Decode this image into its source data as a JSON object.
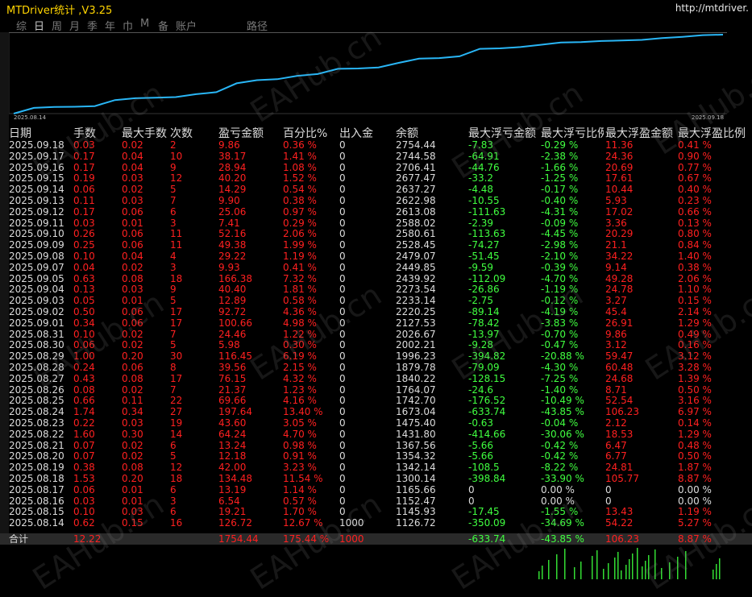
{
  "app_title": "MTDriver统计 ,V3.25",
  "url": "http://mtdriver.",
  "tabs": [
    "综",
    "日",
    "周",
    "月",
    "季",
    "年",
    "巾",
    "M",
    "备",
    "账户",
    "路径"
  ],
  "active_tab": "日",
  "chart": {
    "start_label": "2025.08.14",
    "end_label": "2025.09.18",
    "line_color": "#29b6f6"
  },
  "headers": [
    "日期",
    "手数",
    "最大手数",
    "次数",
    "盈亏金额",
    "百分比%",
    "出入金",
    "余额",
    "最大浮亏金额",
    "最大浮亏比例",
    "最大浮盈金额",
    "最大浮盈比例"
  ],
  "rows": [
    [
      "2025.09.18",
      "0.03",
      "0.02",
      "2",
      "9.86",
      "0.36 %",
      "0",
      "2754.44",
      "-7.83",
      "-0.29 %",
      "11.36",
      "0.41 %"
    ],
    [
      "2025.09.17",
      "0.17",
      "0.04",
      "10",
      "38.17",
      "1.41 %",
      "0",
      "2744.58",
      "-64.91",
      "-2.38 %",
      "24.36",
      "0.90 %"
    ],
    [
      "2025.09.16",
      "0.17",
      "0.04",
      "9",
      "28.94",
      "1.08 %",
      "0",
      "2706.41",
      "-44.76",
      "-1.66 %",
      "20.69",
      "0.77 %"
    ],
    [
      "2025.09.15",
      "0.19",
      "0.03",
      "12",
      "40.20",
      "1.52 %",
      "0",
      "2677.47",
      "-33.2",
      "-1.25 %",
      "17.61",
      "0.67 %"
    ],
    [
      "2025.09.14",
      "0.06",
      "0.02",
      "5",
      "14.29",
      "0.54 %",
      "0",
      "2637.27",
      "-4.48",
      "-0.17 %",
      "10.44",
      "0.40 %"
    ],
    [
      "2025.09.13",
      "0.11",
      "0.03",
      "7",
      "9.90",
      "0.38 %",
      "0",
      "2622.98",
      "-10.55",
      "-0.40 %",
      "5.93",
      "0.23 %"
    ],
    [
      "2025.09.12",
      "0.17",
      "0.06",
      "6",
      "25.06",
      "0.97 %",
      "0",
      "2613.08",
      "-111.63",
      "-4.31 %",
      "17.02",
      "0.66 %"
    ],
    [
      "2025.09.11",
      "0.03",
      "0.01",
      "3",
      "7.41",
      "0.29 %",
      "0",
      "2588.02",
      "-2.39",
      "-0.09 %",
      "3.36",
      "0.13 %"
    ],
    [
      "2025.09.10",
      "0.26",
      "0.06",
      "11",
      "52.16",
      "2.06 %",
      "0",
      "2580.61",
      "-113.63",
      "-4.45 %",
      "20.29",
      "0.80 %"
    ],
    [
      "2025.09.09",
      "0.25",
      "0.06",
      "11",
      "49.38",
      "1.99 %",
      "0",
      "2528.45",
      "-74.27",
      "-2.98 %",
      "21.1",
      "0.84 %"
    ],
    [
      "2025.09.08",
      "0.10",
      "0.04",
      "4",
      "29.22",
      "1.19 %",
      "0",
      "2479.07",
      "-51.45",
      "-2.10 %",
      "34.22",
      "1.40 %"
    ],
    [
      "2025.09.07",
      "0.04",
      "0.02",
      "3",
      "9.93",
      "0.41 %",
      "0",
      "2449.85",
      "-9.59",
      "-0.39 %",
      "9.14",
      "0.38 %"
    ],
    [
      "2025.09.05",
      "0.63",
      "0.08",
      "18",
      "166.38",
      "7.32 %",
      "0",
      "2439.92",
      "-112.09",
      "-4.70 %",
      "49.28",
      "2.06 %"
    ],
    [
      "2025.09.04",
      "0.13",
      "0.03",
      "9",
      "40.40",
      "1.81 %",
      "0",
      "2273.54",
      "-26.86",
      "-1.19 %",
      "24.78",
      "1.10 %"
    ],
    [
      "2025.09.03",
      "0.05",
      "0.01",
      "5",
      "12.89",
      "0.58 %",
      "0",
      "2233.14",
      "-2.75",
      "-0.12 %",
      "3.27",
      "0.15 %"
    ],
    [
      "2025.09.02",
      "0.50",
      "0.06",
      "17",
      "92.72",
      "4.36 %",
      "0",
      "2220.25",
      "-89.14",
      "-4.19 %",
      "45.4",
      "2.14 %"
    ],
    [
      "2025.09.01",
      "0.34",
      "0.06",
      "17",
      "100.66",
      "4.98 %",
      "0",
      "2127.53",
      "-78.42",
      "-3.83 %",
      "26.91",
      "1.29 %"
    ],
    [
      "2025.08.31",
      "0.10",
      "0.02",
      "7",
      "24.46",
      "1.22 %",
      "0",
      "2026.67",
      "-13.97",
      "-0.70 %",
      "9.86",
      "0.49 %"
    ],
    [
      "2025.08.30",
      "0.06",
      "0.02",
      "5",
      "5.98",
      "0.30 %",
      "0",
      "2002.21",
      "-9.28",
      "-0.47 %",
      "3.12",
      "0.16 %"
    ],
    [
      "2025.08.29",
      "1.00",
      "0.20",
      "30",
      "116.45",
      "6.19 %",
      "0",
      "1996.23",
      "-394.82",
      "-20.88 %",
      "59.47",
      "3.12 %"
    ],
    [
      "2025.08.28",
      "0.24",
      "0.06",
      "8",
      "39.56",
      "2.15 %",
      "0",
      "1879.78",
      "-79.09",
      "-4.30 %",
      "60.48",
      "3.28 %"
    ],
    [
      "2025.08.27",
      "0.43",
      "0.08",
      "17",
      "76.15",
      "4.32 %",
      "0",
      "1840.22",
      "-128.15",
      "-7.25 %",
      "24.68",
      "1.39 %"
    ],
    [
      "2025.08.26",
      "0.08",
      "0.02",
      "7",
      "21.37",
      "1.23 %",
      "0",
      "1764.07",
      "-24.6",
      "-1.40 %",
      "8.71",
      "0.50 %"
    ],
    [
      "2025.08.25",
      "0.66",
      "0.11",
      "22",
      "69.66",
      "4.16 %",
      "0",
      "1742.70",
      "-176.52",
      "-10.49 %",
      "52.54",
      "3.16 %"
    ],
    [
      "2025.08.24",
      "1.74",
      "0.34",
      "27",
      "197.64",
      "13.40 %",
      "0",
      "1673.04",
      "-633.74",
      "-43.85 %",
      "106.23",
      "6.97 %"
    ],
    [
      "2025.08.23",
      "0.22",
      "0.03",
      "19",
      "43.60",
      "3.05 %",
      "0",
      "1475.40",
      "-0.63",
      "-0.04 %",
      "2.12",
      "0.14 %"
    ],
    [
      "2025.08.22",
      "1.60",
      "0.30",
      "14",
      "64.24",
      "4.70 %",
      "0",
      "1431.80",
      "-414.66",
      "-30.06 %",
      "18.53",
      "1.29 %"
    ],
    [
      "2025.08.21",
      "0.07",
      "0.02",
      "6",
      "13.24",
      "0.98 %",
      "0",
      "1367.56",
      "-5.66",
      "-0.42 %",
      "6.47",
      "0.48 %"
    ],
    [
      "2025.08.20",
      "0.07",
      "0.02",
      "5",
      "12.18",
      "0.91 %",
      "0",
      "1354.32",
      "-5.66",
      "-0.42 %",
      "6.77",
      "0.50 %"
    ],
    [
      "2025.08.19",
      "0.38",
      "0.08",
      "12",
      "42.00",
      "3.23 %",
      "0",
      "1342.14",
      "-108.5",
      "-8.22 %",
      "24.81",
      "1.87 %"
    ],
    [
      "2025.08.18",
      "1.53",
      "0.20",
      "18",
      "134.48",
      "11.54 %",
      "0",
      "1300.14",
      "-398.84",
      "-33.90 %",
      "105.77",
      "8.87 %"
    ],
    [
      "2025.08.17",
      "0.06",
      "0.01",
      "6",
      "13.19",
      "1.14 %",
      "0",
      "1165.66",
      "0",
      "0.00 %",
      "0",
      "0.00 %"
    ],
    [
      "2025.08.16",
      "0.03",
      "0.01",
      "3",
      "6.54",
      "0.57 %",
      "0",
      "1152.47",
      "0",
      "0.00 %",
      "0",
      "0.00 %"
    ],
    [
      "2025.08.15",
      "0.10",
      "0.03",
      "6",
      "19.21",
      "1.70 %",
      "0",
      "1145.93",
      "-17.45",
      "-1.55 %",
      "13.43",
      "1.19 %"
    ],
    [
      "2025.08.14",
      "0.62",
      "0.15",
      "16",
      "126.72",
      "12.67 %",
      "1000",
      "1126.72",
      "-350.09",
      "-34.69 %",
      "54.22",
      "5.27 %"
    ]
  ],
  "total": {
    "label": "合计",
    "lots": "12.22",
    "pl": "1754.44",
    "pct": "175.44 %",
    "deposit": "1000",
    "float_loss": "-633.74",
    "float_loss_pct": "-43.85 %",
    "float_profit": "106.23",
    "float_profit_pct": "8.87 %"
  },
  "watermark": "EAHub.cn"
}
